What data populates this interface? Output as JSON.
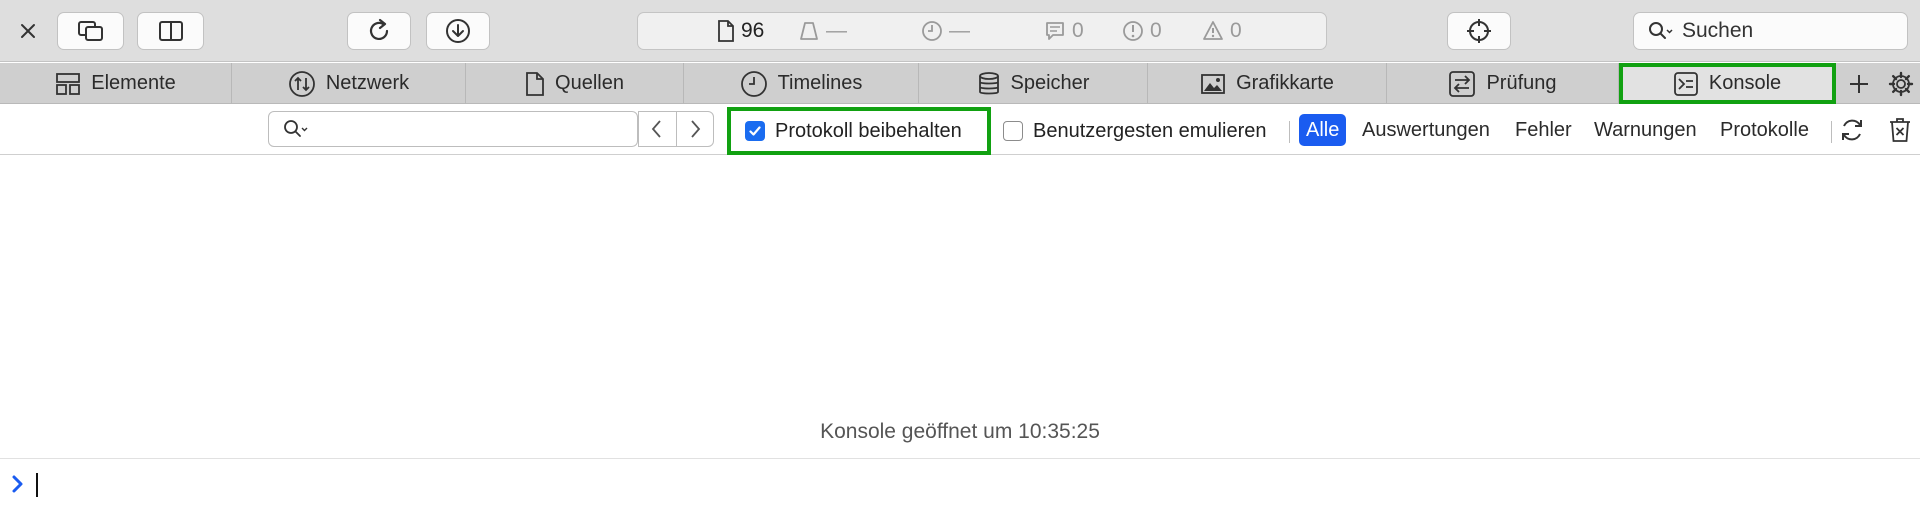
{
  "toolbar": {
    "activity": {
      "resources_count": "96",
      "load_size": "—",
      "load_time": "—",
      "logs": "0",
      "errors": "0",
      "warnings": "0"
    },
    "search_placeholder": "Suchen"
  },
  "tabs": [
    {
      "label": "Elemente",
      "icon": "elements-icon"
    },
    {
      "label": "Netzwerk",
      "icon": "network-icon"
    },
    {
      "label": "Quellen",
      "icon": "sources-icon"
    },
    {
      "label": "Timelines",
      "icon": "clock-icon"
    },
    {
      "label": "Speicher",
      "icon": "storage-icon"
    },
    {
      "label": "Grafikkarte",
      "icon": "graphics-icon"
    },
    {
      "label": "Prüfung",
      "icon": "audit-icon"
    },
    {
      "label": "Konsole",
      "icon": "console-icon",
      "active": true
    }
  ],
  "filterbar": {
    "filter_value": "",
    "preserve_log_label": "Protokoll beibehalten",
    "preserve_log_checked": true,
    "emulate_gestures_label": "Benutzergesten emulieren",
    "emulate_gestures_checked": false,
    "scopes": [
      "Alle",
      "Auswertungen",
      "Fehler",
      "Warnungen",
      "Protokolle"
    ],
    "selected_scope": "Alle"
  },
  "console": {
    "message": "Konsole geöffnet um 10:35:25",
    "input_value": ""
  },
  "colors": {
    "accent": "#1a5cf0",
    "highlight": "#11a111",
    "toolbar_bg": "#dedede",
    "tabbar_bg": "#cfcfcf"
  }
}
